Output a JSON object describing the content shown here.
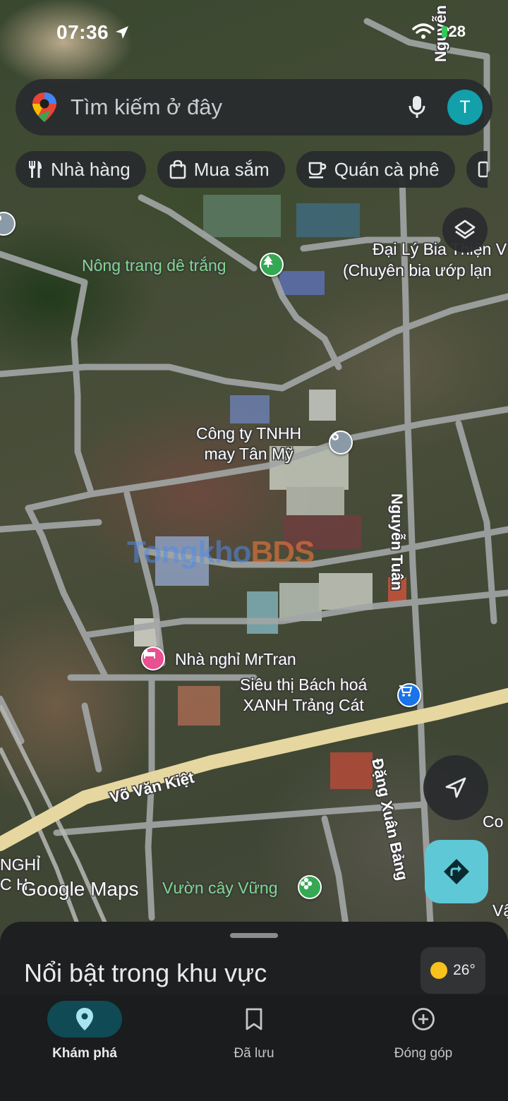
{
  "status_bar": {
    "time": "07:36",
    "battery": "28"
  },
  "search": {
    "placeholder": "Tìm kiếm ở đây",
    "avatar_initial": "T"
  },
  "chips": [
    {
      "label": "Nhà hàng",
      "icon": "fork-knife-icon"
    },
    {
      "label": "Mua sắm",
      "icon": "shopping-bag-icon"
    },
    {
      "label": "Quán cà phê",
      "icon": "coffee-cup-icon"
    }
  ],
  "map": {
    "places": {
      "nong_trang": "Nông trang dê trắng",
      "dai_ly_line1": "Đại Lý Bia Thiện V",
      "dai_ly_line2": "(Chuyên bia ướp lạn",
      "cong_ty_line1": "Công ty TNHH",
      "cong_ty_line2": "may Tân Mỹ",
      "nha_nghi": "Nhà nghỉ MrTran",
      "sieu_thi_line1": "Siêu thị Bách hoá",
      "sieu_thi_line2": "XANH Trảng Cát",
      "vuon_cay": "Vườn cây Vững",
      "edge_co": "Co",
      "edge_va": "Vậ",
      "edge_nghi_line1": "NGHỈ",
      "edge_nghi_line2": "C H"
    },
    "roads": {
      "vo_van_kiet": "Võ Văn Kiệt",
      "nguyen_tuan": "Nguyễn Tuân",
      "dang_xuan_bang": "Đặng Xuân Bảng",
      "nguyen_top": "Nguyễn"
    },
    "watermark_a": "Tongkho",
    "watermark_b": "BDS",
    "attribution": "Google Maps"
  },
  "sheet": {
    "title": "Nổi bật trong khu vực",
    "temperature": "26°"
  },
  "nav": [
    {
      "label": "Khám phá",
      "icon": "map-pin-icon",
      "active": true
    },
    {
      "label": "Đã lưu",
      "icon": "bookmark-icon",
      "active": false
    },
    {
      "label": "Đóng góp",
      "icon": "add-circle-icon",
      "active": false
    }
  ],
  "colors": {
    "accent": "#5ec8d6",
    "nav_active_bg": "#0f4a55",
    "avatar_bg": "#12a0aa",
    "poi_green": "#34a853",
    "poi_pink": "#e8508f",
    "poi_blue": "#1a73e8",
    "poi_gray": "#8a9aa6"
  }
}
